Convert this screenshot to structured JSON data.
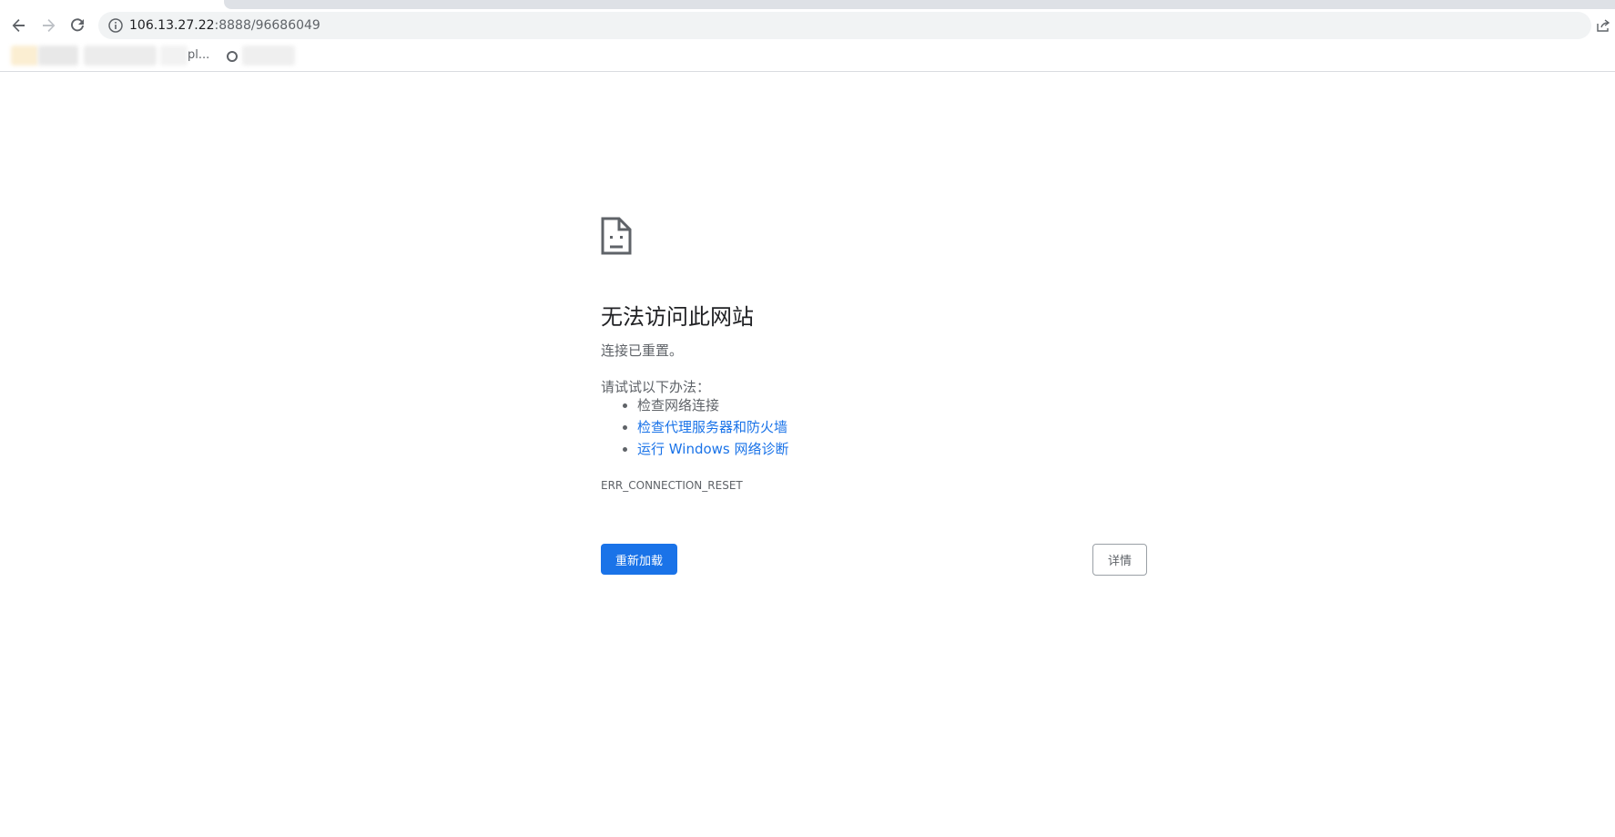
{
  "browser": {
    "url_host": "106.13.27.22",
    "url_rest": ":8888/96686049",
    "bookmarks_partial_text": "pl...",
    "icons": {
      "back": "back-arrow-icon",
      "forward": "forward-arrow-icon",
      "reload": "reload-icon",
      "site_info": "info-icon",
      "share": "share-icon"
    }
  },
  "error": {
    "title": "无法访问此网站",
    "summary": "连接已重置。",
    "try_label": "请试试以下办法：",
    "suggestions": [
      {
        "text": "检查网络连接",
        "link": false
      },
      {
        "text": "检查代理服务器和防火墙",
        "link": true
      },
      {
        "text": "运行 Windows 网络诊断",
        "link": true
      }
    ],
    "error_code": "ERR_CONNECTION_RESET",
    "reload_label": "重新加载",
    "details_label": "详情"
  },
  "colors": {
    "accent": "#1a73e8",
    "text_primary": "#202124",
    "text_secondary": "#5f6368",
    "omnibox_bg": "#f1f3f4"
  }
}
